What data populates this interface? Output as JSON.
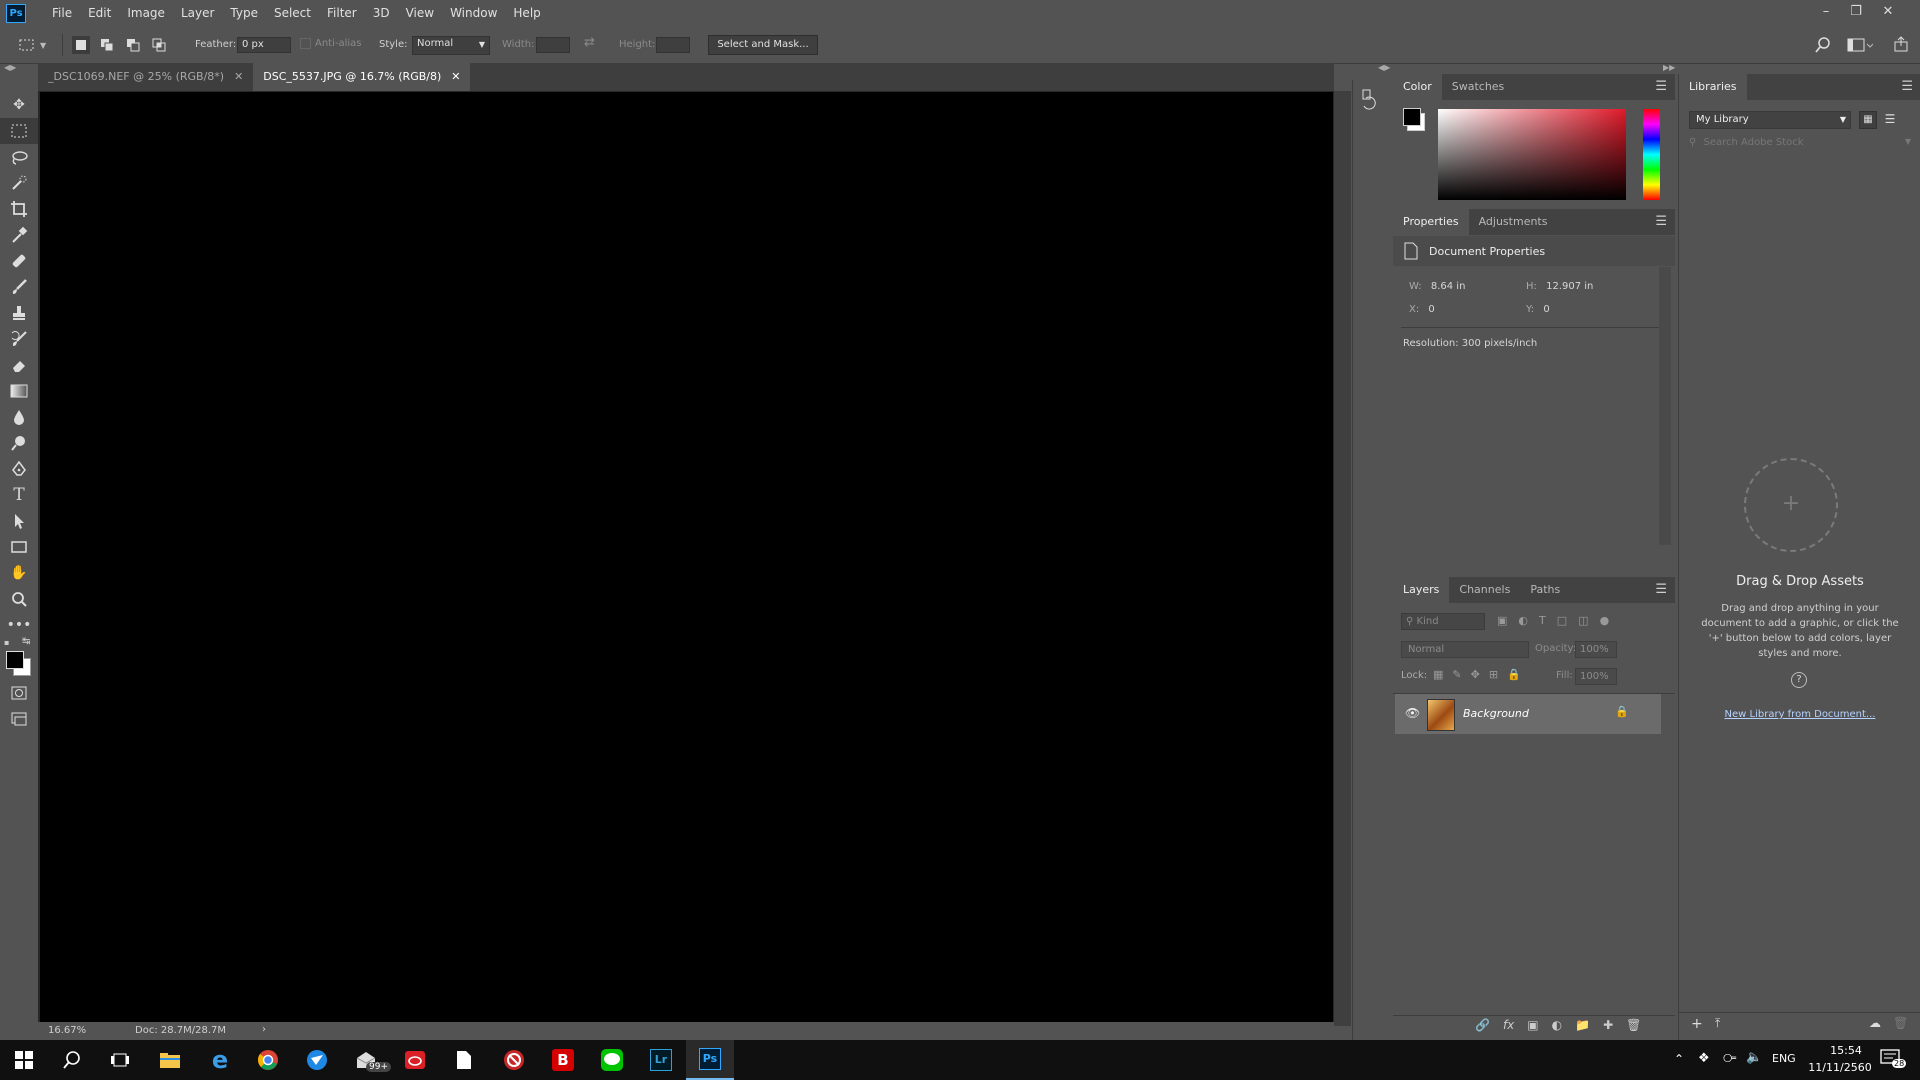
{
  "app": {
    "logo_text": "Ps"
  },
  "menu": [
    "File",
    "Edit",
    "Image",
    "Layer",
    "Type",
    "Select",
    "Filter",
    "3D",
    "View",
    "Window",
    "Help"
  ],
  "options_bar": {
    "feather_label": "Feather:",
    "feather_value": "0 px",
    "antialias_label": "Anti-alias",
    "style_label": "Style:",
    "style_value": "Normal",
    "width_label": "Width:",
    "height_label": "Height:",
    "select_mask_button": "Select and Mask..."
  },
  "tabs": [
    {
      "label": "_DSC1069.NEF @ 25% (RGB/8*)",
      "active": false
    },
    {
      "label": "DSC_5537.JPG @ 16.7% (RGB/8)",
      "active": true
    }
  ],
  "status": {
    "zoom": "16.67%",
    "doc": "Doc: 28.7M/28.7M"
  },
  "color_panel": {
    "tabs": [
      "Color",
      "Swatches"
    ]
  },
  "properties_panel": {
    "tabs": [
      "Properties",
      "Adjustments"
    ],
    "title": "Document Properties",
    "w_label": "W:",
    "w_value": "8.64 in",
    "h_label": "H:",
    "h_value": "12.907 in",
    "x_label": "X:",
    "x_value": "0",
    "y_label": "Y:",
    "y_value": "0",
    "resolution": "Resolution: 300 pixels/inch"
  },
  "layers_panel": {
    "tabs": [
      "Layers",
      "Channels",
      "Paths"
    ],
    "kind_placeholder": "Kind",
    "blend_mode": "Normal",
    "opacity_label": "Opacity:",
    "opacity_value": "100%",
    "lock_label": "Lock:",
    "fill_label": "Fill:",
    "fill_value": "100%",
    "layers": [
      {
        "name": "Background",
        "visible": true,
        "locked": true
      }
    ]
  },
  "libraries_panel": {
    "tab": "Libraries",
    "library_select": "My Library",
    "search_placeholder": "Search Adobe Stock",
    "drop_title": "Drag & Drop Assets",
    "drop_text": "Drag and drop anything in your document to add a graphic, or click the '+' button below to add colors, layer styles and more.",
    "help_glyph": "?",
    "new_library_link": "New Library from Document..."
  },
  "taskbar": {
    "mail_badge": "99+",
    "lr_label": "Lr",
    "ps_label": "Ps",
    "lang": "ENG",
    "time": "15:54",
    "date": "11/11/2560",
    "notif_count": "28"
  },
  "colors": {
    "foreground": "#000000",
    "background": "#ffffff",
    "accent": "#31a8ff",
    "link": "#b4d1ff"
  }
}
